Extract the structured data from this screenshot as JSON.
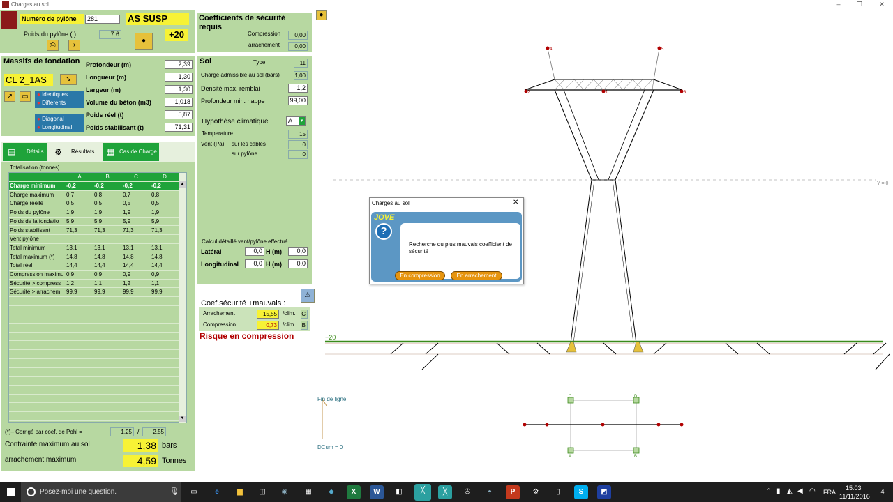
{
  "window": {
    "title": "Charges au sol",
    "min": "–",
    "max": "❐",
    "close": "✕"
  },
  "pylon": {
    "num_label": "Numéro de pylône",
    "num_value": "281",
    "type": "AS SUSP",
    "weight_label": "Poids du pylône (t)",
    "weight_value": "7.6",
    "plus20": "+20"
  },
  "coef_req": {
    "title": "Coefficients de sécurité requis",
    "compression_label": "Compression",
    "compression_value": "0,00",
    "arrachement_label": "arrachement",
    "arrachement_value": "0,00"
  },
  "massifs": {
    "title": "Massifs de fondation",
    "code": "CL 2_1AS",
    "radio1": [
      "Identiques",
      "Differents"
    ],
    "radio2": [
      "Diagonal",
      "Longitudinal"
    ],
    "rows": [
      {
        "label": "Profondeur (m)",
        "value": "2,39"
      },
      {
        "label": "Longueur (m)",
        "value": "1,30"
      },
      {
        "label": "Largeur (m)",
        "value": "1,30"
      },
      {
        "label": "Volume du béton (m3)",
        "value": "1,018"
      },
      {
        "label": "Poids réel (t)",
        "value": "5,87"
      },
      {
        "label": "Poids stabilisant (t)",
        "value": "71,31"
      }
    ]
  },
  "sol": {
    "title": "Sol",
    "type_label": "Type",
    "type_value": "11",
    "charge_label": "Charge admissible au sol (bars)",
    "charge_value": "1,00",
    "densite_label": "Densité max. remblai",
    "densite_value": "1,2",
    "nappe_label": "Profondeur min. nappe",
    "nappe_value": "99,00"
  },
  "hypo": {
    "title": "Hypothèse climatique",
    "select": "A",
    "temp_label": "Temperature",
    "temp_value": "15",
    "vent_label": "Vent (Pa)",
    "cables_label": "sur les câbles",
    "cables_value": "0",
    "pylone_label": "sur pylône",
    "pylone_value": "0",
    "calc_label": "Calcul détaillé vent/pylône effectué",
    "lat_label": "Latéral",
    "lat_value": "0,0",
    "h_label": "H (m)",
    "lat_h": "0,0",
    "long_label": "Longitudinal",
    "long_value": "0,0",
    "long_h": "0,0"
  },
  "tabs": [
    "Détails",
    "Résultats.",
    "Cas de Charge"
  ],
  "table": {
    "title": "Totalisation (tonnes)",
    "headers": [
      "A",
      "B",
      "C",
      "D"
    ],
    "rows": [
      [
        "Charge minimum",
        "-0,2",
        "-0,2",
        "-0,2",
        "-0,2"
      ],
      [
        "Charge maximum",
        "0,7",
        "0,8",
        "0,7",
        "0,8"
      ],
      [
        "Charge réelle",
        "0,5",
        "0,5",
        "0,5",
        "0,5"
      ],
      [
        "Poids du pylône",
        "1,9",
        "1,9",
        "1,9",
        "1,9"
      ],
      [
        "Poids de la fondatio",
        "5,9",
        "5,9",
        "5,9",
        "5,9"
      ],
      [
        "Poids stabilisant",
        "71,3",
        "71,3",
        "71,3",
        "71,3"
      ],
      [
        "Vent pylône",
        "",
        "",
        "",
        ""
      ],
      [
        "Total minimum",
        "13,1",
        "13,1",
        "13,1",
        "13,1"
      ],
      [
        "Total maximum (*)",
        "14,8",
        "14,8",
        "14,8",
        "14,8"
      ],
      [
        "Total réel",
        "14,4",
        "14,4",
        "14,4",
        "14,4"
      ],
      [
        "Compression maximu",
        "0,9",
        "0,9",
        "0,9",
        "0,9"
      ],
      [
        "Sécurité > compress",
        "1,2",
        "1,1",
        "1,2",
        "1,1"
      ],
      [
        "Sécurité > arrachem",
        "99,9",
        "99,9",
        "99,9",
        "99,9"
      ]
    ]
  },
  "footer": {
    "pohl_label": "(*)– Corrigé par coef. de Pohl =",
    "pohl1": "1,25",
    "slash": "/",
    "pohl2": "2,55",
    "contrainte_label": "Contrainte maximum au sol",
    "contrainte_value": "1,38",
    "contrainte_unit": "bars",
    "arr_label": "arrachement maximum",
    "arr_value": "4,59",
    "arr_unit": "Tonnes"
  },
  "mauvais": {
    "title": "Coef.sécurité +mauvais :",
    "arr_label": "Arrachement",
    "arr_value": "15,55",
    "clim": "/clim.",
    "arr_clim": "C",
    "comp_label": "Compression",
    "comp_value": "0,73",
    "comp_clim": "B",
    "risk": "Risque en compression"
  },
  "drawing": {
    "pts": [
      "4",
      "5",
      "2",
      "1",
      "3"
    ],
    "y0": "Y = 0",
    "plus20": "+20",
    "fin": "Fin de ligne",
    "dcum": "DCum = 0",
    "corners": [
      "C",
      "D",
      "A",
      "B"
    ]
  },
  "dialog": {
    "title": "Charges au sol",
    "close": "✕",
    "brand": "JOVE",
    "message": "Recherche du plus mauvais coefficient de sécurité",
    "btn1": "En compression",
    "btn2": "En arrachement"
  },
  "taskbar": {
    "search": "Posez-moi une question.",
    "lang": "FRA",
    "time": "15:03",
    "date": "11/11/2016",
    "notif": "4"
  }
}
